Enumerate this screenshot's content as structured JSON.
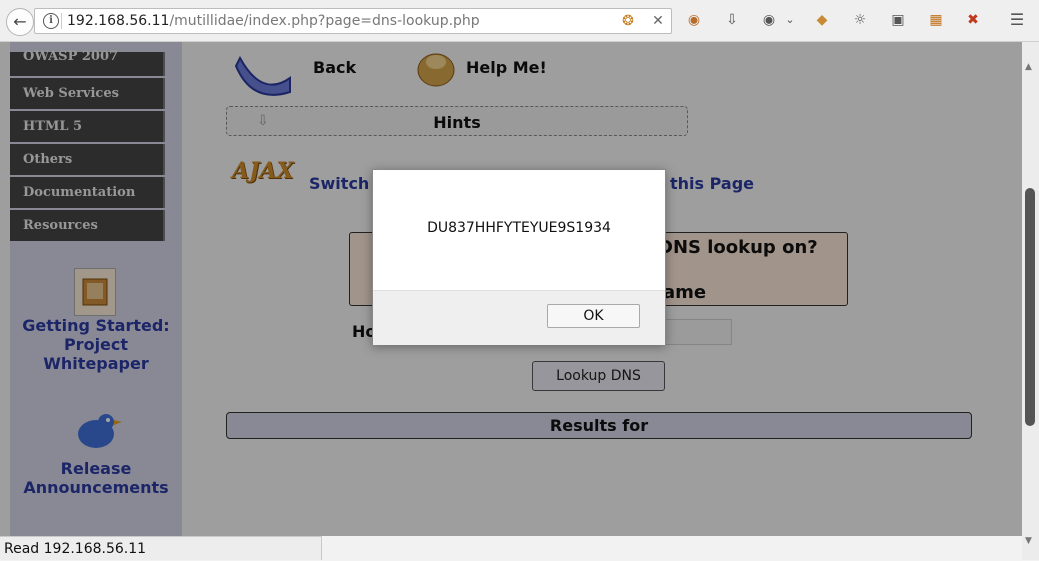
{
  "browser": {
    "url_host": "192.168.56.11",
    "url_path": "/mutillidae/index.php?page=dns-lookup.php",
    "status_text": "Read 192.168.56.11"
  },
  "sidebar": {
    "menu_items": [
      {
        "label": "OWASP 2007"
      },
      {
        "label": "Web Services"
      },
      {
        "label": "HTML 5"
      },
      {
        "label": "Others"
      },
      {
        "label": "Documentation"
      },
      {
        "label": "Resources"
      }
    ],
    "getting_started": [
      "Getting Started:",
      "Project",
      "Whitepaper"
    ],
    "release": [
      "Release",
      "Announcements"
    ]
  },
  "content": {
    "back_label": "Back",
    "help_label": "Help Me!",
    "hints_label": "Hints",
    "switch_text": "Switch",
    "this_page_text": "this Page",
    "dns_question": "DNS lookup on?",
    "dns_name_fragment": "ame",
    "hostname_fragment": "Ho",
    "lookup_button": "Lookup DNS",
    "results_label": "Results for"
  },
  "dialog": {
    "message": "DU837HHFYTEYUE9S1934",
    "ok_label": "OK"
  }
}
